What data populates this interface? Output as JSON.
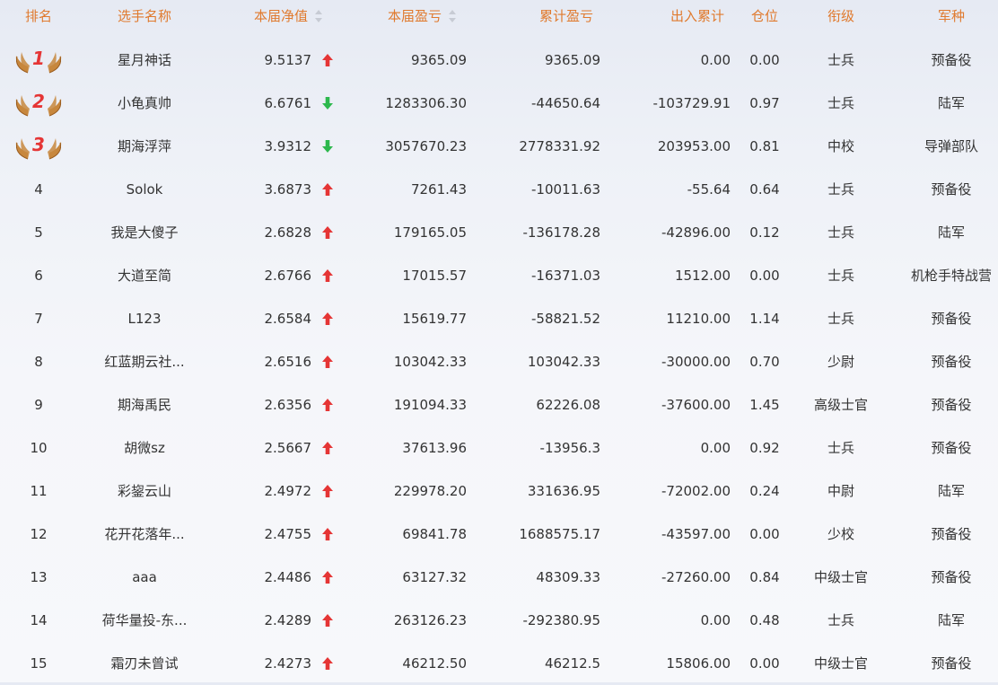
{
  "headers": {
    "rank": "排名",
    "name": "选手名称",
    "nav": "本届净值",
    "pl": "本届盈亏",
    "cum_pl": "累计盈亏",
    "inout": "出入累计",
    "position": "仓位",
    "title": "衔级",
    "branch": "军种"
  },
  "colors": {
    "header_text": "#e07a2e",
    "up_arrow": "#e53535",
    "down_arrow": "#2db84d",
    "rank_number": "#e53535",
    "wing": "#c7873d"
  },
  "rows": [
    {
      "rank": "1",
      "name": "星月神话",
      "nav": "9.5137",
      "trend": "up",
      "pl": "9365.09",
      "cum_pl": "9365.09",
      "inout": "0.00",
      "position": "0.00",
      "title": "士兵",
      "branch": "预备役"
    },
    {
      "rank": "2",
      "name": "小龟真帅",
      "nav": "6.6761",
      "trend": "down",
      "pl": "1283306.30",
      "cum_pl": "-44650.64",
      "inout": "-103729.91",
      "position": "0.97",
      "title": "士兵",
      "branch": "陆军"
    },
    {
      "rank": "3",
      "name": "期海浮萍",
      "nav": "3.9312",
      "trend": "down",
      "pl": "3057670.23",
      "cum_pl": "2778331.92",
      "inout": "203953.00",
      "position": "0.81",
      "title": "中校",
      "branch": "导弹部队"
    },
    {
      "rank": "4",
      "name": "Solok",
      "nav": "3.6873",
      "trend": "up",
      "pl": "7261.43",
      "cum_pl": "-10011.63",
      "inout": "-55.64",
      "position": "0.64",
      "title": "士兵",
      "branch": "预备役"
    },
    {
      "rank": "5",
      "name": "我是大傻子",
      "nav": "2.6828",
      "trend": "up",
      "pl": "179165.05",
      "cum_pl": "-136178.28",
      "inout": "-42896.00",
      "position": "0.12",
      "title": "士兵",
      "branch": "陆军"
    },
    {
      "rank": "6",
      "name": "大道至简",
      "nav": "2.6766",
      "trend": "up",
      "pl": "17015.57",
      "cum_pl": "-16371.03",
      "inout": "1512.00",
      "position": "0.00",
      "title": "士兵",
      "branch": "机枪手特战营"
    },
    {
      "rank": "7",
      "name": "L123",
      "nav": "2.6584",
      "trend": "up",
      "pl": "15619.77",
      "cum_pl": "-58821.52",
      "inout": "11210.00",
      "position": "1.14",
      "title": "士兵",
      "branch": "预备役"
    },
    {
      "rank": "8",
      "name": "红蓝期云社...",
      "nav": "2.6516",
      "trend": "up",
      "pl": "103042.33",
      "cum_pl": "103042.33",
      "inout": "-30000.00",
      "position": "0.70",
      "title": "少尉",
      "branch": "预备役"
    },
    {
      "rank": "9",
      "name": "期海禹民",
      "nav": "2.6356",
      "trend": "up",
      "pl": "191094.33",
      "cum_pl": "62226.08",
      "inout": "-37600.00",
      "position": "1.45",
      "title": "高级士官",
      "branch": "预备役"
    },
    {
      "rank": "10",
      "name": "胡微sz",
      "nav": "2.5667",
      "trend": "up",
      "pl": "37613.96",
      "cum_pl": "-13956.3",
      "inout": "0.00",
      "position": "0.92",
      "title": "士兵",
      "branch": "预备役"
    },
    {
      "rank": "11",
      "name": "彩鋆云山",
      "nav": "2.4972",
      "trend": "up",
      "pl": "229978.20",
      "cum_pl": "331636.95",
      "inout": "-72002.00",
      "position": "0.24",
      "title": "中尉",
      "branch": "陆军"
    },
    {
      "rank": "12",
      "name": "花开花落年...",
      "nav": "2.4755",
      "trend": "up",
      "pl": "69841.78",
      "cum_pl": "1688575.17",
      "inout": "-43597.00",
      "position": "0.00",
      "title": "少校",
      "branch": "预备役"
    },
    {
      "rank": "13",
      "name": "aaa",
      "nav": "2.4486",
      "trend": "up",
      "pl": "63127.32",
      "cum_pl": "48309.33",
      "inout": "-27260.00",
      "position": "0.84",
      "title": "中级士官",
      "branch": "预备役"
    },
    {
      "rank": "14",
      "name": "荷华量投-东...",
      "nav": "2.4289",
      "trend": "up",
      "pl": "263126.23",
      "cum_pl": "-292380.95",
      "inout": "0.00",
      "position": "0.48",
      "title": "士兵",
      "branch": "陆军"
    },
    {
      "rank": "15",
      "name": "霜刃未曾试",
      "nav": "2.4273",
      "trend": "up",
      "pl": "46212.50",
      "cum_pl": "46212.5",
      "inout": "15806.00",
      "position": "0.00",
      "title": "中级士官",
      "branch": "预备役"
    }
  ]
}
